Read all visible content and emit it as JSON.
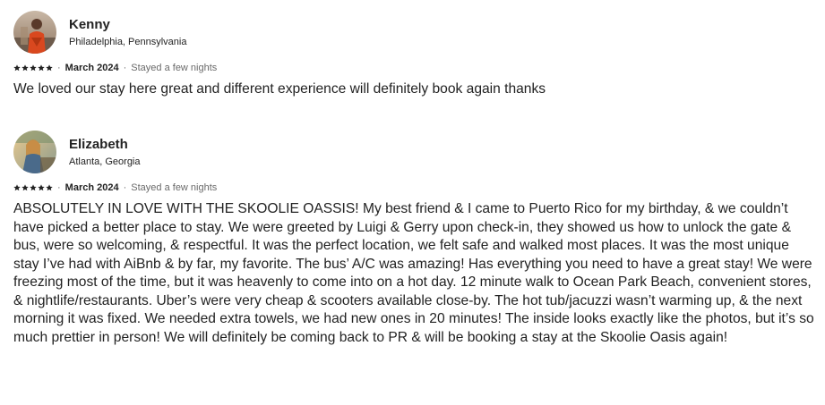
{
  "colors": {
    "text": "#222222",
    "muted": "#6a6a6a",
    "star": "#222222"
  },
  "reviews": [
    {
      "name": "Kenny",
      "location": "Philadelphia, Pennsylvania",
      "rating": 5,
      "date": "March 2024",
      "separator": "·",
      "stay": "Stayed a few nights",
      "text": "We loved our stay here great and different experience will definitely book again thanks",
      "avatar_icon": "avatar-photo"
    },
    {
      "name": "Elizabeth",
      "location": "Atlanta, Georgia",
      "rating": 5,
      "date": "March 2024",
      "separator": "·",
      "stay": "Stayed a few nights",
      "text": "ABSOLUTELY IN LOVE WITH THE SKOOLIE OASSIS! My best friend & I came to Puerto Rico for my birthday, & we couldn’t have picked a better place to stay. We were greeted by Luigi & Gerry upon check-in, they showed us how to unlock the gate & bus, were so welcoming, & respectful. It was the perfect location, we felt safe and walked most places. It was the most unique stay I’ve had with AiBnb & by far, my favorite. The bus’ A/C was amazing! Has everything you need to have a great stay! We were freezing most of the time, but it was heavenly to come into on a hot day. 12 minute walk to Ocean Park Beach, convenient stores, & nightlife/restaurants. Uber’s were very cheap & scooters available close-by. The hot tub/jacuzzi wasn’t warming up, & the next morning it was fixed. We needed extra towels, we had new ones in 20 minutes! The inside looks exactly like the photos, but it’s so much prettier in person! We will definitely be coming back to PR & will be booking a stay at the Skoolie Oasis again!",
      "avatar_icon": "avatar-photo"
    }
  ]
}
